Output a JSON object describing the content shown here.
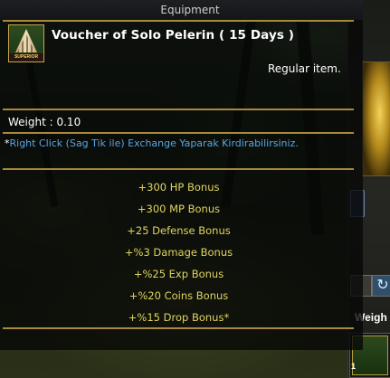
{
  "window": {
    "title": "Equipment"
  },
  "item": {
    "icon_label": "SUPERIOR CAPE",
    "name": "Voucher of Solo Pelerin ( 15 Days )",
    "type": "Regular item.",
    "weight": "Weight : 0.10",
    "description_prefix": "*",
    "description": "Right Click (Sag Tik ile) Exchange Yaparak Kirdirabilirsiniz.",
    "bonuses": [
      "+300 HP Bonus",
      "+300 MP Bonus",
      "+25 Defense Bonus",
      "+%3 Damage Bonus",
      "+%25 Exp Bonus",
      "+%20 Coins Bonus",
      "+%15 Drop Bonus*"
    ]
  },
  "side_panel": {
    "weight_label": "Weigh",
    "item_count": "1"
  },
  "colors": {
    "gold_rule": "#a88a3c",
    "bonus_text": "#e0d45f",
    "description_text": "#5aa5e8"
  }
}
